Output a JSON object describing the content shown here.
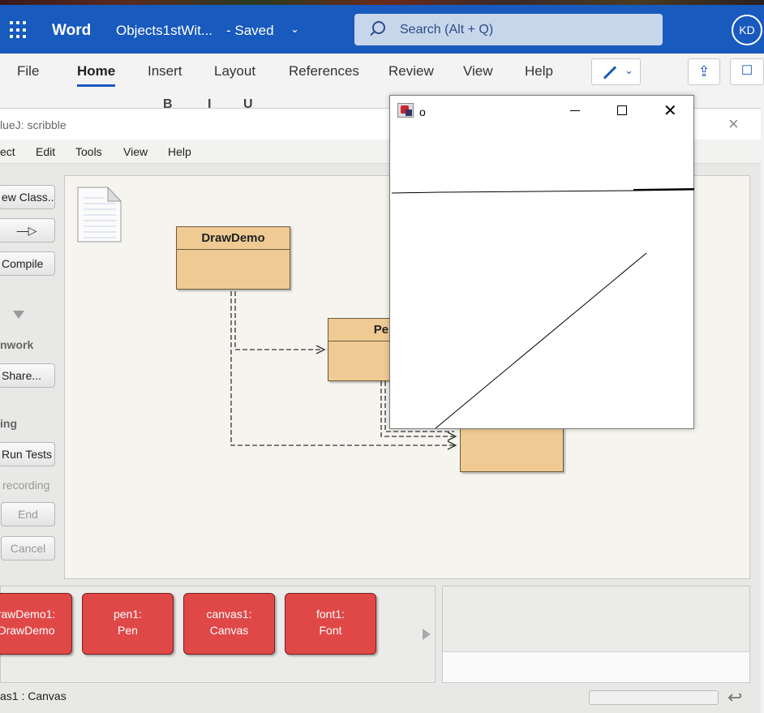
{
  "word": {
    "app_name": "Word",
    "doc_title": "Objects1stWit...",
    "doc_status": "- Saved",
    "title_chevron": "⌄",
    "search_placeholder": "Search (Alt + Q)",
    "avatar_initials": "KD",
    "tabs": [
      {
        "label": "File"
      },
      {
        "label": "Home",
        "active": true
      },
      {
        "label": "Insert"
      },
      {
        "label": "Layout"
      },
      {
        "label": "References"
      },
      {
        "label": "Review"
      },
      {
        "label": "View"
      },
      {
        "label": "Help"
      }
    ],
    "edit_chevron": "⌄",
    "share_glyph": "⇪",
    "comments_glyph": "☐",
    "ribbon_partial": [
      "B",
      "I",
      "U"
    ]
  },
  "bluej": {
    "window_title": "lueJ:  scribble",
    "close_glyph": "×",
    "menu": [
      "ect",
      "Edit",
      "Tools",
      "View",
      "Help"
    ],
    "sidebar": {
      "new_class": "ew Class...",
      "arrow_glyph": "—▷",
      "compile": "Compile",
      "teamwork_heading": "nwork",
      "share": "Share...",
      "testing_heading": "ing",
      "run_tests": "Run Tests",
      "recording": "recording",
      "end": "End",
      "cancel": "Cancel"
    },
    "classes": [
      {
        "name": "DrawDemo"
      },
      {
        "name": "Pen"
      },
      {
        "name": ""
      }
    ],
    "objects": [
      {
        "line1": "rawDemo1:",
        "line2": "DrawDemo"
      },
      {
        "line1": "pen1:",
        "line2": "Pen"
      },
      {
        "line1": "canvas1:",
        "line2": "Canvas"
      },
      {
        "line1": "font1:",
        "line2": "Font"
      }
    ],
    "status_text": "as1 : Canvas",
    "undo_glyph": "↩"
  },
  "java_window": {
    "title": "o",
    "close_glyph": "✕"
  }
}
